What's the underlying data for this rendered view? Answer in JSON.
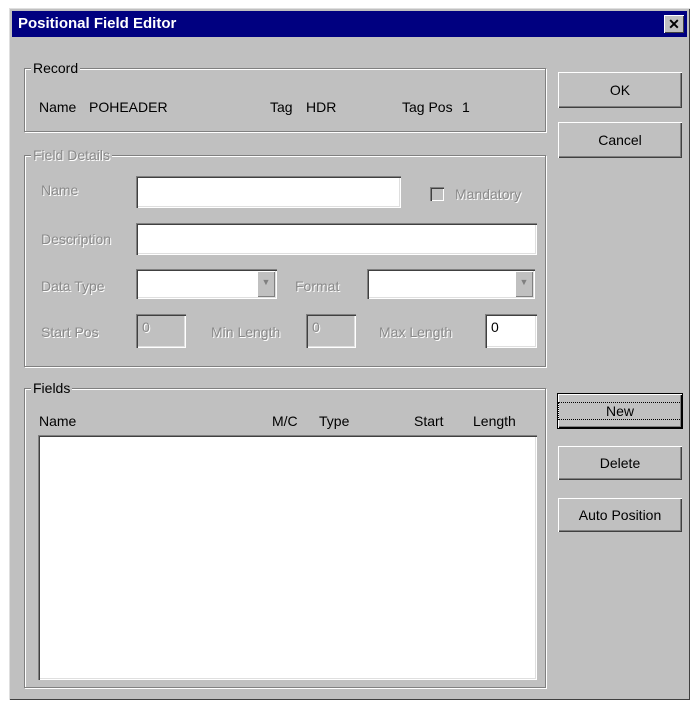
{
  "window": {
    "title": "Positional Field Editor",
    "close_glyph": "✕"
  },
  "record": {
    "group_label": "Record",
    "name_label": "Name",
    "name_value": "POHEADER",
    "tag_label": "Tag",
    "tag_value": "HDR",
    "tagpos_label": "Tag Pos",
    "tagpos_value": "1"
  },
  "field_details": {
    "group_label": "Field Details",
    "name_label": "Name",
    "name_value": "",
    "mandatory_label": "Mandatory",
    "mandatory_checked": false,
    "description_label": "Description",
    "description_value": "",
    "datatype_label": "Data Type",
    "datatype_value": "",
    "format_label": "Format",
    "format_value": "",
    "startpos_label": "Start Pos",
    "startpos_value": "0",
    "minlength_label": "Min Length",
    "minlength_value": "0",
    "maxlength_label": "Max Length",
    "maxlength_value": "0"
  },
  "fields": {
    "group_label": "Fields",
    "columns": [
      "Name",
      "M/C",
      "Type",
      "Start",
      "Length"
    ],
    "rows": []
  },
  "buttons": {
    "ok": "OK",
    "cancel": "Cancel",
    "new": "New",
    "delete": "Delete",
    "auto_position": "Auto Position"
  },
  "icons": {
    "close": "close-icon",
    "dropdown": "chevron-down-icon"
  }
}
